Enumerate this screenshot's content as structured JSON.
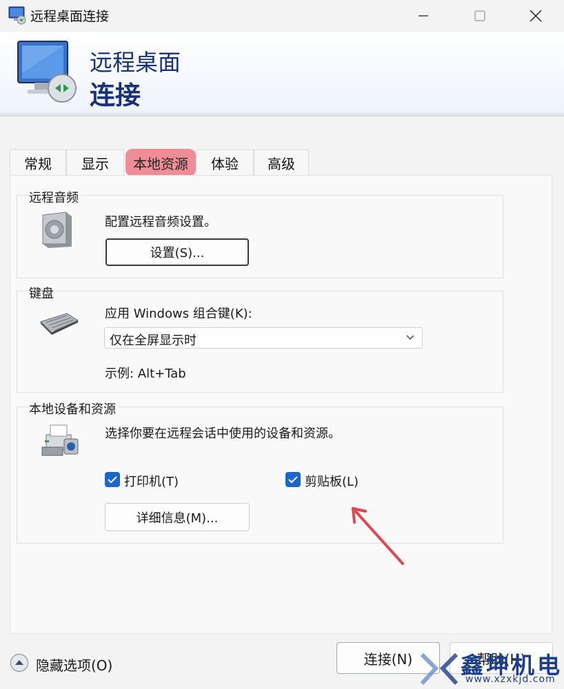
{
  "window": {
    "title": "远程桌面连接",
    "controls": {
      "minimize_icon": "minimize-icon",
      "maximize_icon": "maximize-icon",
      "close_icon": "close-icon"
    }
  },
  "banner": {
    "line1": "远程桌面",
    "line2": "连接",
    "accent_color": "#17327a"
  },
  "tabs": [
    {
      "label": "常规",
      "active": false
    },
    {
      "label": "显示",
      "active": false
    },
    {
      "label": "本地资源",
      "active": true
    },
    {
      "label": "体验",
      "active": false
    },
    {
      "label": "高级",
      "active": false
    }
  ],
  "remote_audio": {
    "title": "远程音频",
    "description": "配置远程音频设置。",
    "settings_button": "设置(S)..."
  },
  "keyboard": {
    "title": "键盘",
    "label": "应用 Windows 组合键(K):",
    "selected": "仅在全屏显示时",
    "example": "示例: Alt+Tab"
  },
  "local_devices": {
    "title": "本地设备和资源",
    "description": "选择你要在远程会话中使用的设备和资源。",
    "printer": {
      "label": "打印机(T)",
      "checked": true
    },
    "clipboard": {
      "label": "剪贴板(L)",
      "checked": true
    },
    "more_button": "详细信息(M)..."
  },
  "footer": {
    "hide_options": "隐藏选项(O)",
    "connect_button": "连接(N)",
    "help_button": "帮助(H)"
  },
  "watermark": {
    "name": "鑫坤机电",
    "url": "www.xzxkjd.com"
  },
  "colors": {
    "checkbox": "#1b66c9",
    "annotation_arrow": "#e0474c",
    "active_tab": "#ee8d95"
  }
}
